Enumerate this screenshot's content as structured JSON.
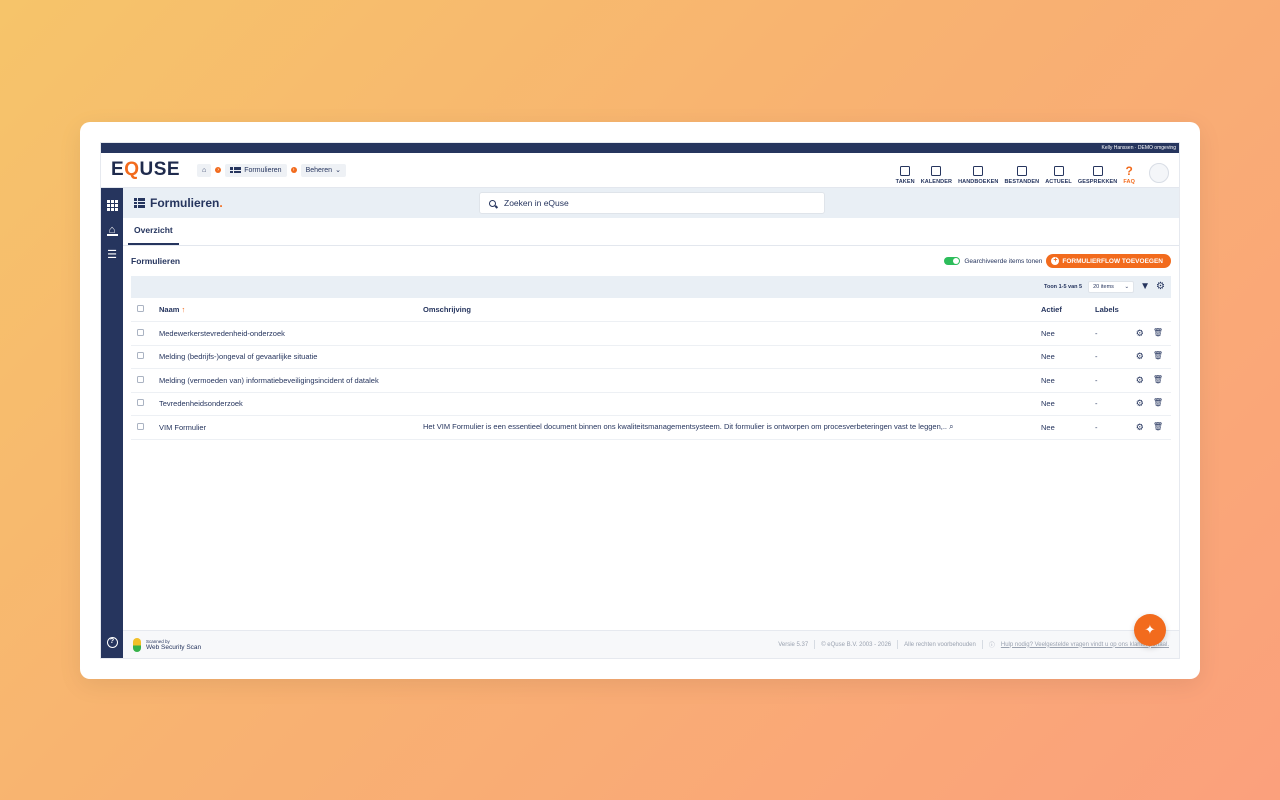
{
  "user_strip": "Kelly Hanssen · DEMO omgeving",
  "brand": {
    "pre": "E",
    "q": "Q",
    "post": "USE"
  },
  "breadcrumbs": {
    "home_icon": "home-icon",
    "item1": "Formulieren",
    "item2": "Beheren"
  },
  "topnav": [
    {
      "label": "TAKEN",
      "icon": "clipboard-icon"
    },
    {
      "label": "KALENDER",
      "icon": "calendar-icon"
    },
    {
      "label": "HANDBOEKEN",
      "icon": "book-icon"
    },
    {
      "label": "BESTANDEN",
      "icon": "archive-icon"
    },
    {
      "label": "ACTUEEL",
      "icon": "news-icon"
    },
    {
      "label": "GESPREKKEN",
      "icon": "chat-icon"
    },
    {
      "label": "FAQ",
      "icon": "question-icon"
    }
  ],
  "faq_glyph": "?",
  "page": {
    "title": "Formulieren",
    "title_dot": ".",
    "search_placeholder": "Zoeken in eQuse"
  },
  "tabs": [
    {
      "label": "Overzicht",
      "active": true
    }
  ],
  "section": {
    "title": "Formulieren",
    "toggle_label": "Gearchiveerde items tonen",
    "add_button": "FORMULIERFLOW TOEVOEGEN"
  },
  "toolbar": {
    "pager": "Toon 1-5 van 5",
    "page_size": "20 items"
  },
  "table": {
    "headers": {
      "name": "Naam",
      "sort_arrow": "↑",
      "description": "Omschrijving",
      "active": "Actief",
      "labels": "Labels"
    },
    "rows": [
      {
        "name": "Medewerkerstevredenheid-onderzoek",
        "description": "",
        "active": "Nee",
        "labels": "-"
      },
      {
        "name": "Melding (bedrijfs-)ongeval of gevaarlijke situatie",
        "description": "",
        "active": "Nee",
        "labels": "-"
      },
      {
        "name": "Melding (vermoeden van) informatiebeveiligingsincident of datalek",
        "description": "",
        "active": "Nee",
        "labels": "-"
      },
      {
        "name": "Tevredenheidsonderzoek",
        "description": "",
        "active": "Nee",
        "labels": "-"
      },
      {
        "name": "VIM Formulier",
        "description": "Het VIM Formulier is een essentieel document binnen ons kwaliteitsmanagementsysteem. Dit formulier is ontworpen om procesverbeteringen vast te leggen,..",
        "active": "Nee",
        "labels": "-"
      }
    ]
  },
  "footer": {
    "scan_line1": "Scanned by",
    "scan_line2": "Web Security Scan",
    "version": "Versie 5.37",
    "copyright": "© eQuse B.V. 2003 - 2026",
    "rights": "Alle rechten voorbehouden",
    "help": "Hulp nodig? Veelgestelde vragen vindt u op ons klantenportaal."
  },
  "colors": {
    "navy": "#26355e",
    "accent": "#f26b1d",
    "toggle_on": "#2dbd5b"
  }
}
